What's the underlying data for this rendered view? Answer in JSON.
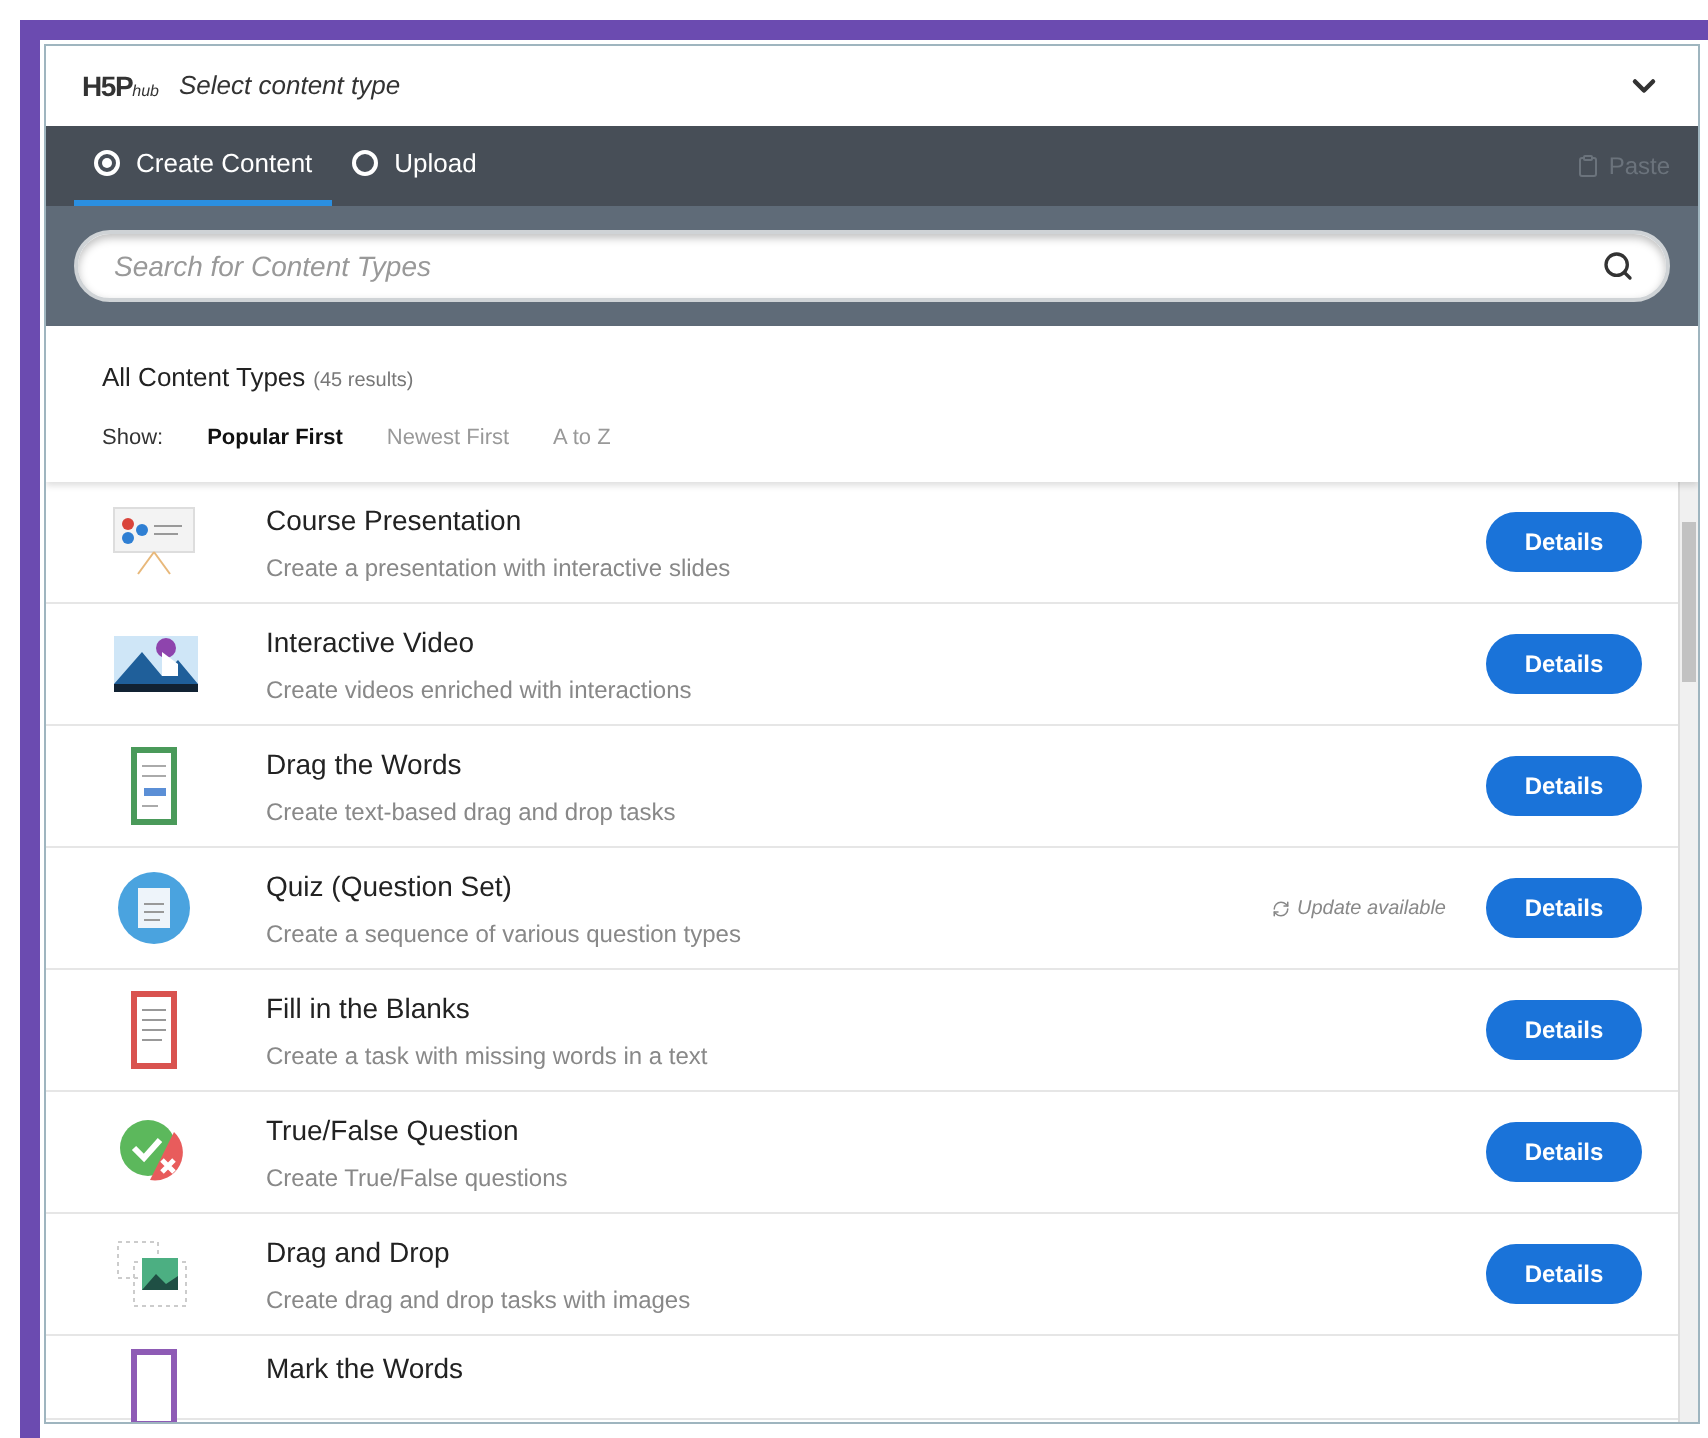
{
  "header": {
    "logo": "H5P",
    "logo_sub": "hub",
    "title": "Select content type"
  },
  "tabs": [
    {
      "label": "Create Content",
      "selected": true
    },
    {
      "label": "Upload",
      "selected": false
    }
  ],
  "paste": {
    "label": "Paste",
    "disabled": true
  },
  "search": {
    "placeholder": "Search for Content Types"
  },
  "results": {
    "title": "All Content Types",
    "count": "(45 results)"
  },
  "sort": {
    "label": "Show:",
    "options": [
      {
        "label": "Popular First",
        "selected": true
      },
      {
        "label": "Newest First",
        "selected": false
      },
      {
        "label": "A to Z",
        "selected": false
      }
    ]
  },
  "items": [
    {
      "kind": "presentation",
      "title": "Course Presentation",
      "description": "Create a presentation with interactive slides",
      "button": "Details"
    },
    {
      "kind": "video",
      "title": "Interactive Video",
      "description": "Create videos enriched with interactions",
      "button": "Details"
    },
    {
      "kind": "dragwords",
      "title": "Drag the Words",
      "description": "Create text-based drag and drop tasks",
      "button": "Details"
    },
    {
      "kind": "quiz",
      "title": "Quiz (Question Set)",
      "description": "Create a sequence of various question types",
      "update": "Update available",
      "button": "Details"
    },
    {
      "kind": "blanks",
      "title": "Fill in the Blanks",
      "description": "Create a task with missing words in a text",
      "button": "Details"
    },
    {
      "kind": "truefalse",
      "title": "True/False Question",
      "description": "Create True/False questions",
      "button": "Details"
    },
    {
      "kind": "dragdrop",
      "title": "Drag and Drop",
      "description": "Create drag and drop tasks with images",
      "button": "Details"
    },
    {
      "kind": "markwords",
      "title": "Mark the Words"
    }
  ]
}
